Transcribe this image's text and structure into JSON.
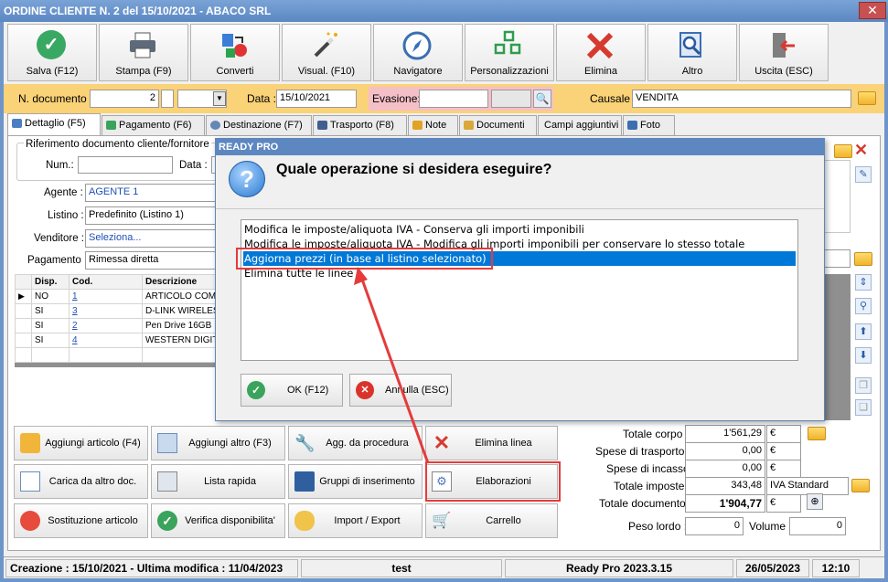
{
  "window": {
    "title": "ORDINE CLIENTE N. 2 del 15/10/2021 - ABACO SRL",
    "close": "✕"
  },
  "toolbar": [
    {
      "label": "Salva (F12)",
      "icon": "check-icon"
    },
    {
      "label": "Stampa (F9)",
      "icon": "printer-icon"
    },
    {
      "label": "Converti",
      "icon": "convert-icon"
    },
    {
      "label": "Visual. (F10)",
      "icon": "wand-icon"
    },
    {
      "label": "Navigatore",
      "icon": "compass-icon"
    },
    {
      "label": "Personalizzazioni",
      "icon": "grid-icon"
    },
    {
      "label": "Elimina",
      "icon": "delete-icon"
    },
    {
      "label": "Altro",
      "icon": "magnifier-icon"
    },
    {
      "label": "Uscita (ESC)",
      "icon": "exit-icon"
    }
  ],
  "header": {
    "doc_label": "N. documento :",
    "doc_value": "2",
    "data_label": "Data :",
    "data_value": "15/10/2021",
    "evasione_label": "Evasione:",
    "causale_label": "Causale :",
    "causale_value": "VENDITA"
  },
  "tabs": [
    "Dettaglio (F5)",
    "Pagamento (F6)",
    "Destinazione (F7)",
    "Trasporto (F8)",
    "Note",
    "Documenti",
    "Campi aggiuntivi",
    "Foto"
  ],
  "form": {
    "rif_label": "Riferimento documento cliente/fornitore",
    "num_label": "Num.:",
    "data_label": "Data :",
    "agente_label": "Agente :",
    "agente_value": "AGENTE 1",
    "listino_label": "Listino :",
    "listino_value": "Predefinito (Listino 1)",
    "venditore_label": "Venditore :",
    "venditore_value": "Seleziona...",
    "pagamento_label": "Pagamento :",
    "pagamento_value": "Rimessa diretta"
  },
  "grid": {
    "columns": [
      "Disp.",
      "Cod.",
      "Descrizione"
    ],
    "rows": [
      {
        "disp": "NO",
        "cod": "1",
        "desc": "ARTICOLO COM"
      },
      {
        "disp": "SI",
        "cod": "3",
        "desc": "D-LINK WIRELES"
      },
      {
        "disp": "SI",
        "cod": "2",
        "desc": "Pen Drive 16GB"
      },
      {
        "disp": "SI",
        "cod": "4",
        "desc": "WESTERN DIGIT"
      }
    ]
  },
  "actions": [
    {
      "label": "Aggiungi articolo (F4)"
    },
    {
      "label": "Aggiungi altro (F3)"
    },
    {
      "label": "Agg. da procedura"
    },
    {
      "label": "Elimina linea"
    },
    {
      "label": "Carica da altro doc."
    },
    {
      "label": "Lista rapida"
    },
    {
      "label": "Gruppi di inserimento"
    },
    {
      "label": "Elaborazioni"
    },
    {
      "label": "Sostituzione articolo"
    },
    {
      "label": "Verifica disponibilita'"
    },
    {
      "label": "Import / Export"
    },
    {
      "label": "Carrello"
    }
  ],
  "totals": {
    "corpo_label": "Totale corpo :",
    "corpo_value": "1'561,29",
    "corpo_cur": "€",
    "trasporto_label": "Spese di trasporto :",
    "trasporto_value": "0,00",
    "trasporto_cur": "€",
    "incasso_label": "Spese di incasso :",
    "incasso_value": "0,00",
    "incasso_cur": "€",
    "imposte_label": "Totale imposte :",
    "imposte_value": "343,48",
    "imposte_note": "IVA Standard",
    "documento_label": "Totale documento :",
    "documento_value": "1'904,77",
    "documento_cur": "€",
    "peso_label": "Peso lordo :",
    "peso_value": "0",
    "volume_label": "Volume :",
    "volume_value": "0"
  },
  "status": {
    "creazione": "Creazione : 15/10/2021 - Ultima modifica : 11/04/2023",
    "user": "test",
    "version": "Ready Pro 2023.3.15",
    "date": "26/05/2023",
    "time": "12:10"
  },
  "dialog": {
    "title": "READY PRO",
    "question": "Quale operazione si desidera eseguire?",
    "options": [
      "Modifica le imposte/aliquota IVA - Conserva gli importi imponibili",
      "Modifica le imposte/aliquota IVA - Modifica gli importi imponibili per conservare lo stesso totale",
      "Aggiorna prezzi (in base al listino selezionato)",
      "Elimina tutte le linee"
    ],
    "selected_index": 2,
    "ok_label": "OK (F12)",
    "cancel_label": "Annulla (ESC)"
  },
  "colors": {
    "accent": "#0078d7",
    "highlight": "#e53b3b",
    "header_bg": "#fad277",
    "title_bg": "#5b87c3"
  }
}
